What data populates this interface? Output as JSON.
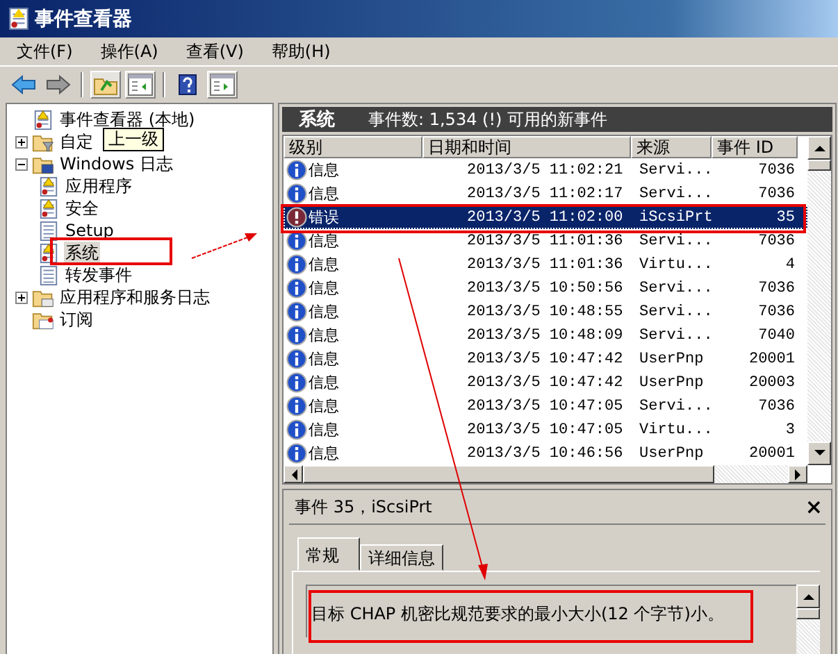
{
  "window": {
    "title": "事件查看器"
  },
  "menu": [
    "文件(F)",
    "操作(A)",
    "查看(V)",
    "帮助(H)"
  ],
  "toolbar": [
    {
      "kind": "back",
      "pressed": false
    },
    {
      "kind": "forward",
      "pressed": false
    },
    {
      "kind": "separator"
    },
    {
      "kind": "up",
      "pressed": true
    },
    {
      "kind": "tree-pane",
      "pressed": true
    },
    {
      "kind": "separator"
    },
    {
      "kind": "help",
      "pressed": false
    },
    {
      "kind": "action-pane",
      "pressed": true
    }
  ],
  "tree": [
    {
      "label": "事件查看器 (本地)",
      "kind": "viewer",
      "selected": false,
      "children": [
        {
          "label": "自定",
          "kind": "filter-folder",
          "expanded": false,
          "selected": false
        },
        {
          "label": "Windows 日志",
          "kind": "windows-folder",
          "expanded": true,
          "selected": false,
          "children": [
            {
              "label": "应用程序",
              "kind": "log",
              "selected": false
            },
            {
              "label": "安全",
              "kind": "log",
              "selected": false
            },
            {
              "label": "Setup",
              "kind": "plain-log",
              "selected": false
            },
            {
              "label": "系统",
              "kind": "log",
              "selected": true
            },
            {
              "label": "转发事件",
              "kind": "plain-log",
              "selected": false
            }
          ]
        },
        {
          "label": "应用程序和服务日志",
          "kind": "folder",
          "expanded": false,
          "selected": false
        },
        {
          "label": "订阅",
          "kind": "subscription",
          "selected": false
        }
      ]
    }
  ],
  "tooltip": {
    "text": "上一级"
  },
  "panel": {
    "title": "系统",
    "summary": "事件数: 1,534 (!) 可用的新事件"
  },
  "table": {
    "columns": [
      "级别",
      "日期和时间",
      "来源",
      "事件 ID"
    ],
    "rows": [
      {
        "kind": "info",
        "severity": "信息",
        "datetime": "2013/3/5 11:02:21",
        "source": "Servi...",
        "event_id": "7036",
        "selected": false
      },
      {
        "kind": "info",
        "severity": "信息",
        "datetime": "2013/3/5 11:02:17",
        "source": "Servi...",
        "event_id": "7036",
        "selected": false
      },
      {
        "kind": "error",
        "severity": "错误",
        "datetime": "2013/3/5 11:02:00",
        "source": "iScsiPrt",
        "event_id": "35",
        "selected": true
      },
      {
        "kind": "info",
        "severity": "信息",
        "datetime": "2013/3/5 11:01:36",
        "source": "Servi...",
        "event_id": "7036",
        "selected": false
      },
      {
        "kind": "info",
        "severity": "信息",
        "datetime": "2013/3/5 11:01:36",
        "source": "Virtu...",
        "event_id": "4",
        "selected": false
      },
      {
        "kind": "info",
        "severity": "信息",
        "datetime": "2013/3/5 10:50:56",
        "source": "Servi...",
        "event_id": "7036",
        "selected": false
      },
      {
        "kind": "info",
        "severity": "信息",
        "datetime": "2013/3/5 10:48:55",
        "source": "Servi...",
        "event_id": "7036",
        "selected": false
      },
      {
        "kind": "info",
        "severity": "信息",
        "datetime": "2013/3/5 10:48:09",
        "source": "Servi...",
        "event_id": "7040",
        "selected": false
      },
      {
        "kind": "info",
        "severity": "信息",
        "datetime": "2013/3/5 10:47:42",
        "source": "UserPnp",
        "event_id": "20001",
        "selected": false
      },
      {
        "kind": "info",
        "severity": "信息",
        "datetime": "2013/3/5 10:47:42",
        "source": "UserPnp",
        "event_id": "20003",
        "selected": false
      },
      {
        "kind": "info",
        "severity": "信息",
        "datetime": "2013/3/5 10:47:05",
        "source": "Servi...",
        "event_id": "7036",
        "selected": false
      },
      {
        "kind": "info",
        "severity": "信息",
        "datetime": "2013/3/5 10:47:05",
        "source": "Virtu...",
        "event_id": "3",
        "selected": false
      },
      {
        "kind": "info",
        "severity": "信息",
        "datetime": "2013/3/5 10:46:56",
        "source": "UserPnp",
        "event_id": "20001",
        "selected": false
      }
    ]
  },
  "details": {
    "title": "事件 35，iScsiPrt",
    "close": "×",
    "tabs": [
      {
        "label": "常规",
        "selected": true
      },
      {
        "label": "详细信息",
        "selected": false
      }
    ],
    "message": "目标 CHAP 机密比规范要求的最小大小(12 个字节)小。"
  }
}
